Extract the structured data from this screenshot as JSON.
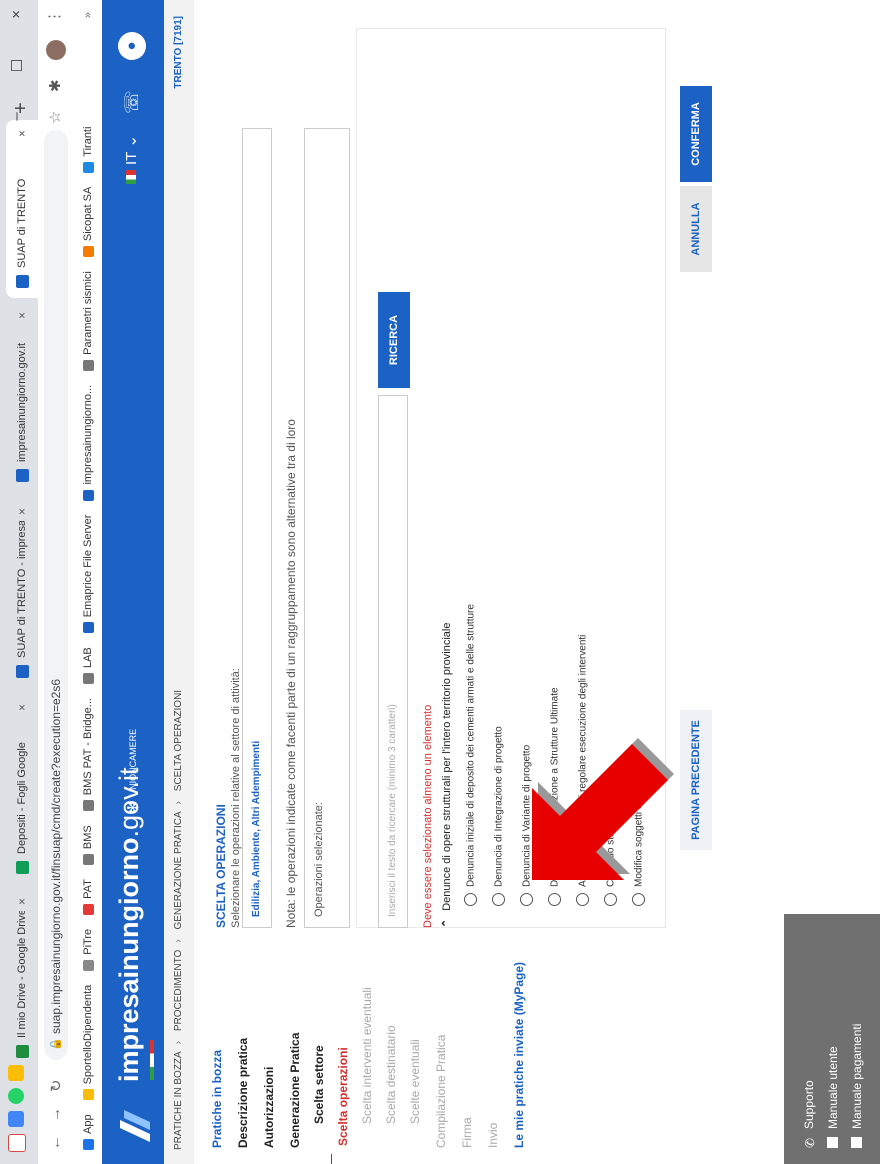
{
  "browser": {
    "tabs": [
      {
        "label": "Il mio Drive - Google Drive",
        "color": "#1e8e3e"
      },
      {
        "label": "Depositi - Fogli Google",
        "color": "#0f9d58"
      },
      {
        "label": "SUAP di TRENTO - impresai",
        "color": "#1c62c4"
      },
      {
        "label": "impresainungiorno.gov.it",
        "color": "#1c62c4"
      },
      {
        "label": "SUAP di TRENTO",
        "color": "#1c62c4"
      }
    ],
    "url": "suap.impresainungiorno.gov.it/finsuap/cmd/create?execution=e2s6",
    "bookmarks": [
      "App",
      "SportelloDipendenta",
      "PiTre",
      "PAT",
      "BMS",
      "BMS PAT - Bridge...",
      "LAB",
      "Emaprice File Server",
      "impresainungiorno...",
      "Parametri sismici",
      "Sicopat SA",
      "Tiranti"
    ]
  },
  "header": {
    "brand_bold": "impresainungiorno",
    "brand_light": ".gov.it",
    "partner": "UNIONCAMERE",
    "lang": "IT"
  },
  "breadcrumb": {
    "items": [
      "PRATICHE IN BOZZA",
      "PROCEDIMENTO",
      "GENERAZIONE PRATICA",
      "SCELTA OPERAZIONI"
    ],
    "location": "TRENTO [7191]"
  },
  "sidebar": {
    "items": [
      "Pratiche in bozza",
      "Descrizione pratica",
      "Autorizzazioni",
      "Generazione Pratica",
      "Scelta settore",
      "Scelta operazioni",
      "Scelta interventi eventuali",
      "Scelta destinatario",
      "Scelte eventuali",
      "Compilazione Pratica",
      "Firma",
      "Invio",
      "Le mie pratiche inviate (MyPage)"
    ],
    "support": [
      "Supporto",
      "Manuale utente",
      "Manuale pagamenti"
    ]
  },
  "main": {
    "section_title": "SCELTA OPERAZIONI",
    "instruction": "Selezionare le operazioni relative al settore di attività:",
    "sector_tag": "Edilizia, Ambiente, Altri Adempimenti",
    "note": "Nota: le operazioni indicate come facenti parte di un raggruppamento sono alternative tra di loro",
    "selected_label": "Operazioni selezionate:",
    "search_placeholder": "Inserisci il testo da ricercare (minimo 3 caratteri)",
    "search_button": "RICERCA",
    "warning": "Deve essere selezionato almeno un elemento",
    "group_title": "Denunce di opere strutturali per l'intero territorio provinciale",
    "options": [
      "Denuncia iniziale di deposito dei cementi armati e delle strutture",
      "Denuncia di Integrazione di progetto",
      "Denuncia di Variante di progetto",
      "Deposito della Relazione a Strutture Ultimate",
      "Attestazione finale di regolare esecuzione degli interventi",
      "Collaudo statico",
      "Modifica soggetti coinvolti"
    ],
    "prev_button": "PAGINA PRECEDENTE",
    "cancel_button": "ANNULLA",
    "confirm_button": "CONFERMA"
  },
  "colors": {
    "brand_blue": "#1c62c4",
    "warning_red": "#d32f2f",
    "arrow_red": "#e60000"
  }
}
